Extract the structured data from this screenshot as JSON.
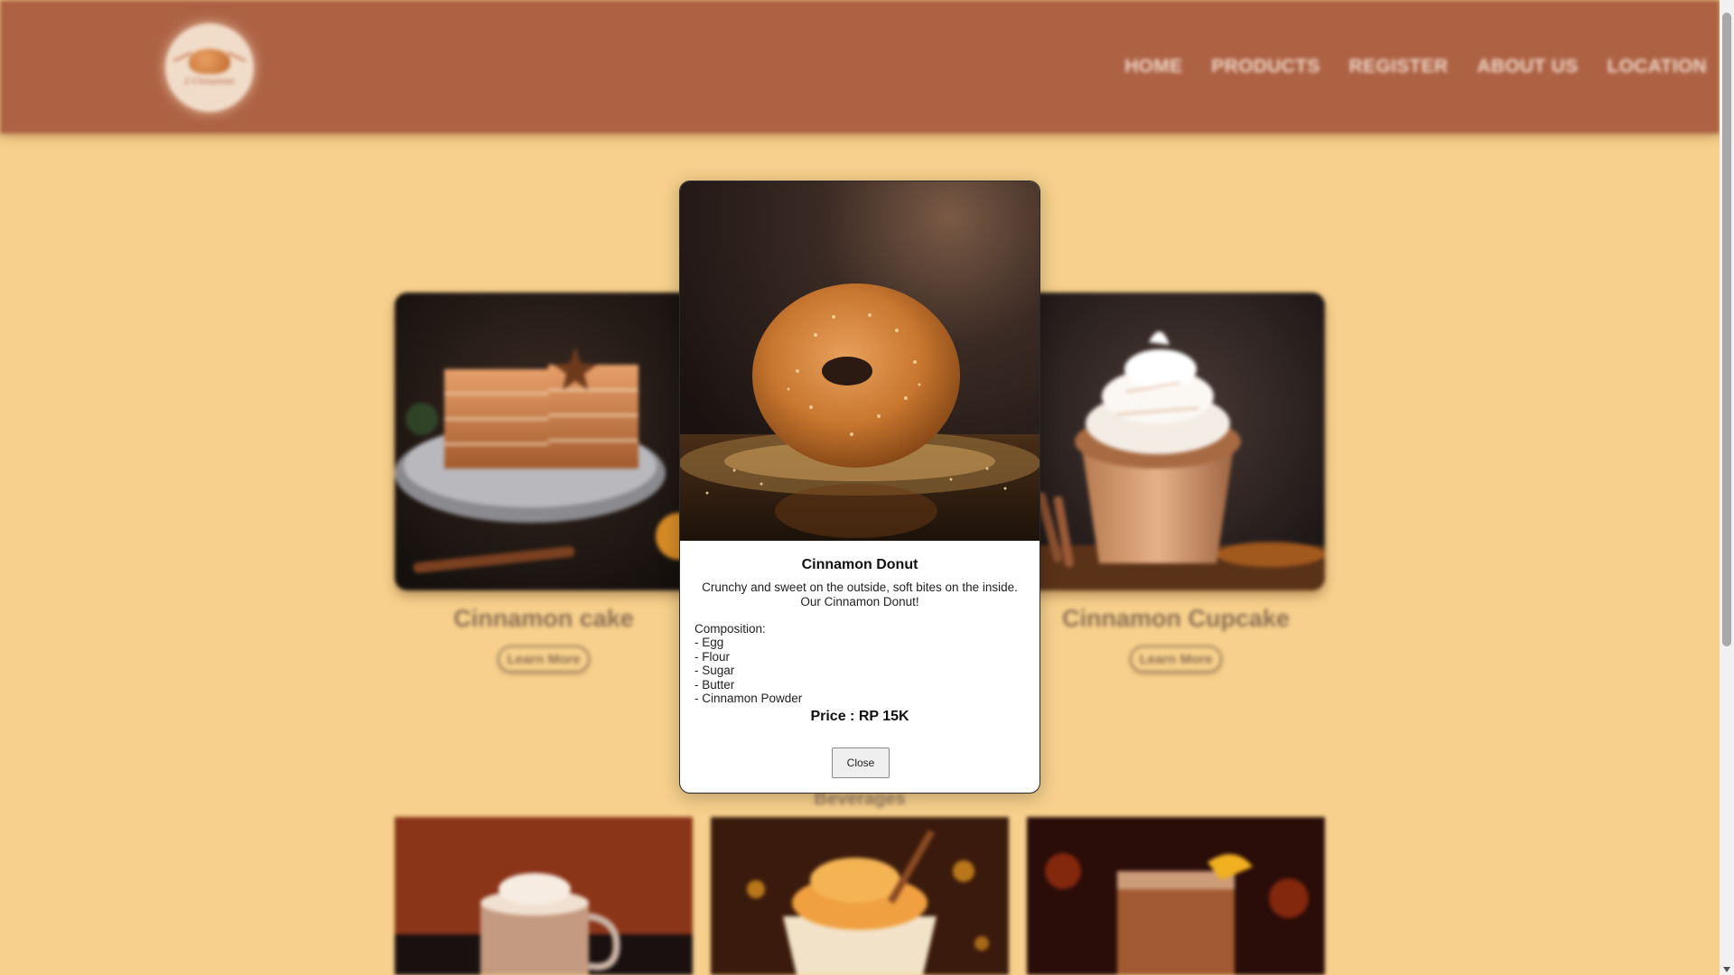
{
  "brand": {
    "logo_text": "L'Cinnamon"
  },
  "nav": {
    "items": [
      {
        "label": "HOME"
      },
      {
        "label": "PRODUCTS"
      },
      {
        "label": "REGISTER"
      },
      {
        "label": "ABOUT US"
      },
      {
        "label": "LOCATION"
      }
    ]
  },
  "products": {
    "cards": [
      {
        "title": "Cinnamon cake",
        "button": "Learn More"
      },
      {
        "title": "Cinnamon Cupcake",
        "button": "Learn More"
      }
    ]
  },
  "beverages": {
    "heading": "Beverages"
  },
  "modal": {
    "title": "Cinnamon Donut",
    "description": "Crunchy and sweet on the outside, soft bites on the inside. Our Cinnamon Donut!",
    "composition": "Composition:\n- Egg\n- Flour\n- Sugar\n- Butter\n- Cinnamon Powder",
    "price": "Price : RP 15K",
    "close_label": "Close"
  },
  "colors": {
    "page_bg": "#f6d08c",
    "header_bg": "#ad6244",
    "nav_text": "#f0d7c8",
    "card_title": "#8d6e52"
  }
}
